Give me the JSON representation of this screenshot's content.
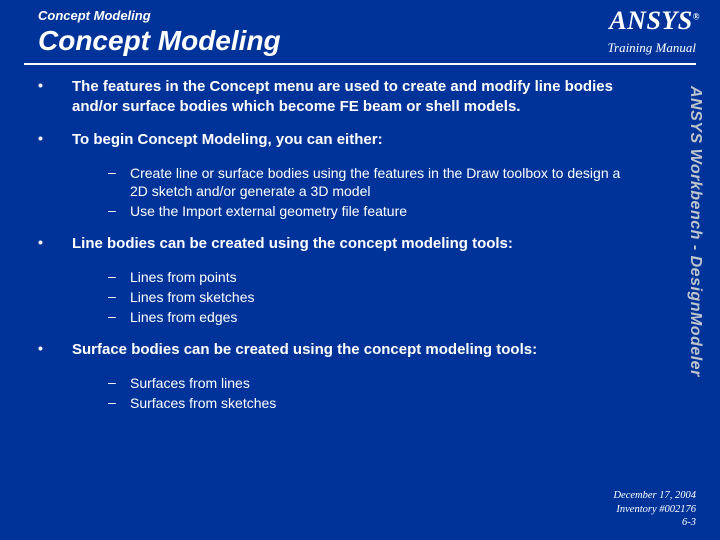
{
  "header": {
    "breadcrumb": "Concept Modeling",
    "title": "Concept Modeling",
    "logo": "ANSYS",
    "logo_r": "®",
    "training_label": "Training Manual"
  },
  "side_label": "ANSYS Workbench - DesignModeler",
  "bullets": [
    {
      "text": "The features in the Concept menu are used to create and modify line bodies and/or surface bodies which become FE beam or shell models.",
      "sub": []
    },
    {
      "text": "To begin Concept Modeling, you can either:",
      "sub": [
        "Create line or surface bodies using the features in the Draw toolbox to design a 2D sketch and/or generate a 3D model",
        "Use the Import external geometry file feature"
      ]
    },
    {
      "text": "Line bodies can be created using the concept modeling tools:",
      "sub": [
        "Lines from points",
        "Lines from sketches",
        "Lines from edges"
      ]
    },
    {
      "text": "Surface bodies can be created using the concept modeling tools:",
      "sub": [
        "Surfaces from lines",
        "Surfaces from sketches"
      ]
    }
  ],
  "footer": {
    "date": "December 17, 2004",
    "inventory": "Inventory #002176",
    "page": "6-3"
  }
}
